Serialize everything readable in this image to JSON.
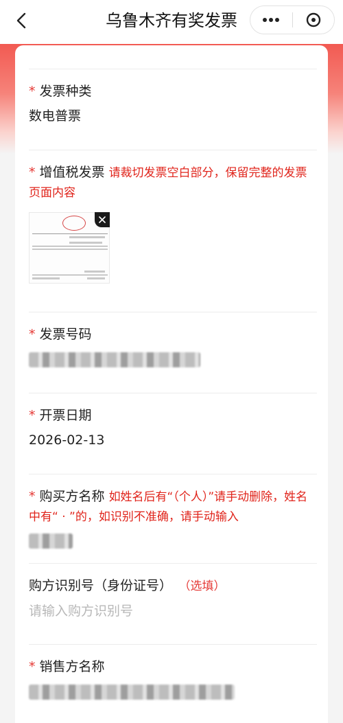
{
  "header": {
    "title": "乌鲁木齐有奖发票"
  },
  "form": {
    "invoice_type": {
      "required": "*",
      "label": "发票种类",
      "value": "数电普票"
    },
    "vat_invoice": {
      "required": "*",
      "label": "增值税发票",
      "hint": "请裁切发票空白部分，保留完整的发票页面内容"
    },
    "invoice_number": {
      "required": "*",
      "label": "发票号码"
    },
    "issue_date": {
      "required": "*",
      "label": "开票日期",
      "value": "2026-02-13"
    },
    "buyer_name": {
      "required": "*",
      "label": "购买方名称",
      "hint": "如姓名后有“（个人）”请手动删除，姓名中有“ · ”的，如识别不准确，请手动输入"
    },
    "buyer_id": {
      "label": "购方识别号（身份证号）",
      "optional": "（选填）",
      "placeholder": "请输入购方识别号"
    },
    "seller_name": {
      "required": "*",
      "label": "销售方名称"
    }
  },
  "colors": {
    "accent_red": "#e0241b",
    "banner_top": "#f25a52"
  },
  "icons": [
    "chevron-left-icon",
    "more-dots-icon",
    "close-circle-icon",
    "thumbnail-close-icon"
  ]
}
